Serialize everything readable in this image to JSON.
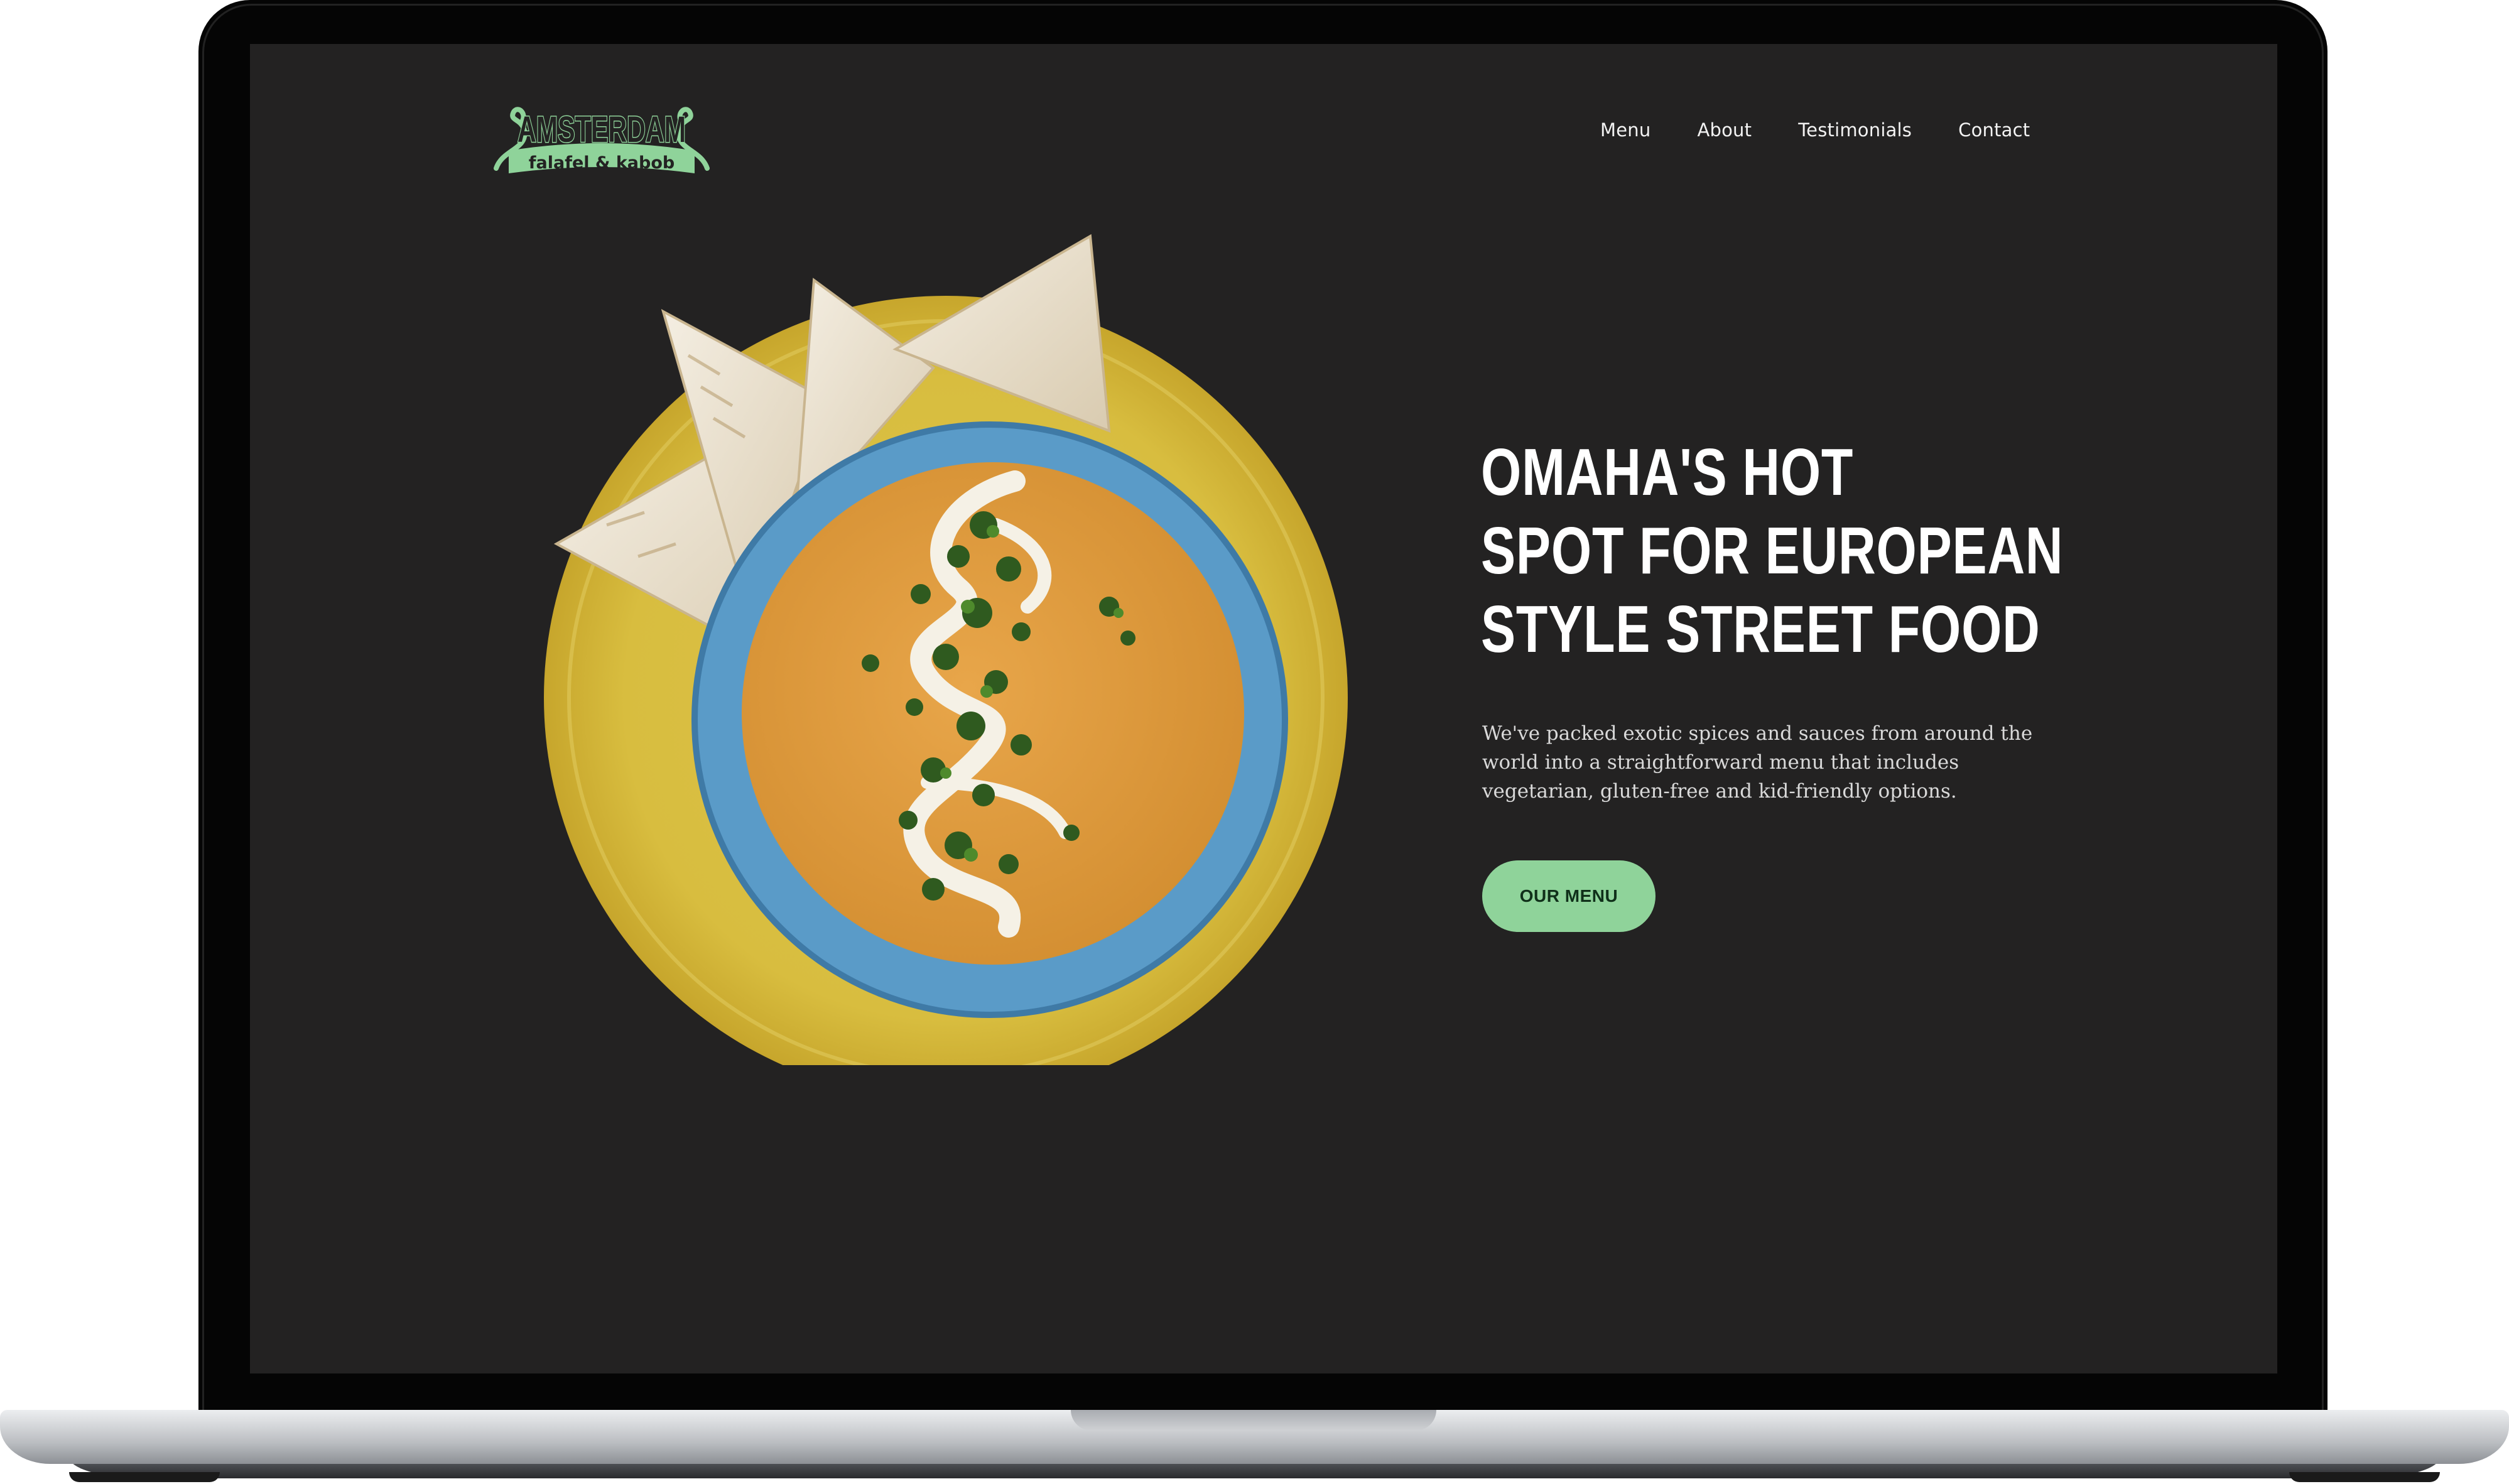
{
  "brand": {
    "logo_word": "AMSTERDAM",
    "logo_sub": "falafel & kabob",
    "logo_color": "#8fd39a"
  },
  "nav": {
    "items": [
      {
        "label": "Menu"
      },
      {
        "label": "About"
      },
      {
        "label": "Testimonials"
      },
      {
        "label": "Contact"
      }
    ]
  },
  "hero": {
    "headline_lines": [
      "OMAHA'S HOT",
      "SPOT FOR EUROPEAN",
      "STYLE STREET FOOD"
    ],
    "tagline": "We've packed exotic spices and sauces from around the world into a straightforward menu that includes vegetarian, gluten-free and kid-friendly options.",
    "cta_label": "OUR MENU"
  },
  "colors": {
    "page_background": "#232222",
    "accent": "#8fd39a",
    "text": "#ffffff"
  }
}
